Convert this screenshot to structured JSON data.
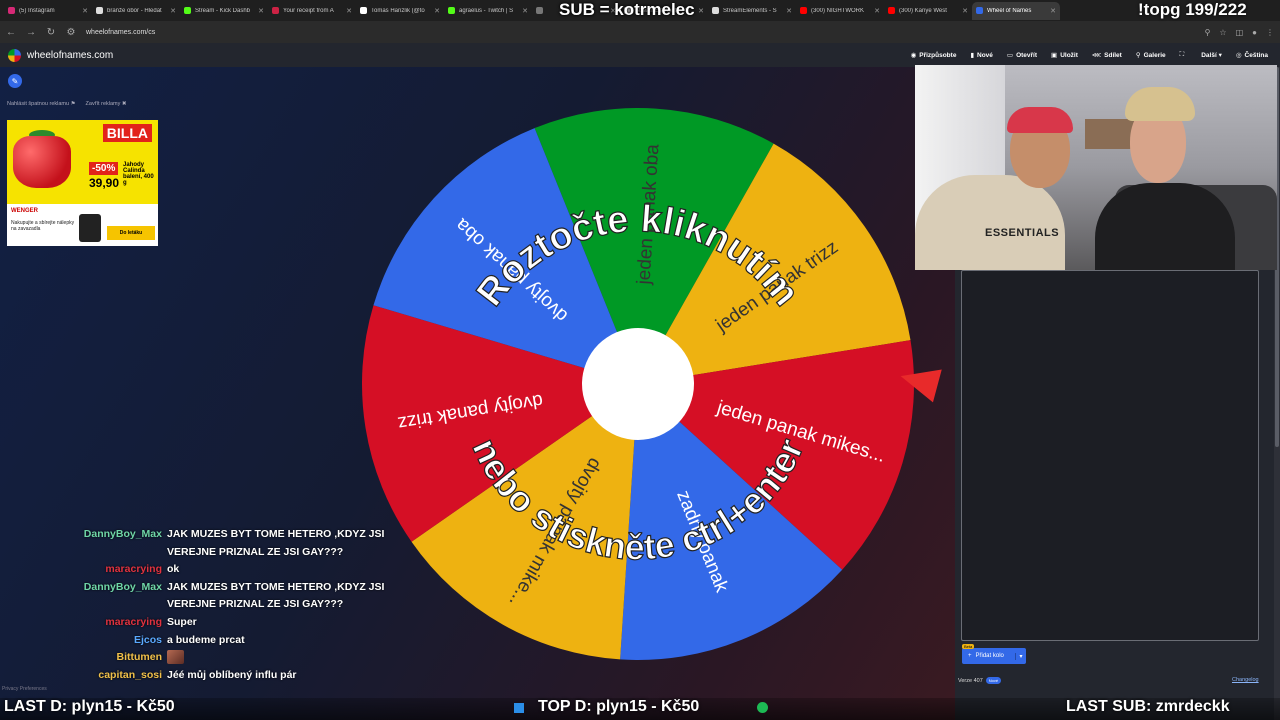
{
  "browser": {
    "tabs": [
      {
        "label": "(5) Instagram",
        "color": "#d62976"
      },
      {
        "label": "branže obor - Hledat",
        "color": "#dddddd"
      },
      {
        "label": "Stream - Kick Dashb",
        "color": "#53fc18"
      },
      {
        "label": "Your receipt from A",
        "color": "#cc2244"
      },
      {
        "label": "Tomas Hanzlik (@to",
        "color": "#ffffff"
      },
      {
        "label": "agraelus - Twitch | S",
        "color": "#53fc18"
      },
      {
        "label": "",
        "color": "#777777"
      },
      {
        "label": "StreamElements - S",
        "color": "#dddddd"
      },
      {
        "label": "StreamElements - S",
        "color": "#dddddd"
      },
      {
        "label": "(300) NIGHTWORK",
        "color": "#ff0000"
      },
      {
        "label": "(300) Kanye West",
        "color": "#ff0000"
      },
      {
        "label": "Wheel of Names",
        "color": "#3369e8"
      }
    ],
    "url": "wheelofnames.com/cs"
  },
  "site": {
    "name": "wheelofnames.com",
    "menu": [
      "Přizpůsobte",
      "Nové",
      "Otevřít",
      "Uložit",
      "Sdílet",
      "Galerie",
      "",
      "Další",
      "Čeština"
    ]
  },
  "ad": {
    "links": [
      "Nahlásit špatnou reklamu",
      "Zavřít reklamy"
    ],
    "brand": "BILLA",
    "discount": "-50%",
    "price": "39,90",
    "product": "Jahody Calinda balení, 400 g",
    "partner": "WENGER",
    "text": "Nakupujte a sbírejte nálepky na zavazadla",
    "cta": "Do letáku"
  },
  "wheel": {
    "overlay_top": "Roztočte kliknutím",
    "overlay_bottom": "nebo stiskněte ctrl+enter",
    "colors": {
      "blue": "#3369e8",
      "red": "#d50f25",
      "yellow": "#eeb211",
      "green": "#009925"
    },
    "segments": [
      {
        "label": "jeden panak oba",
        "color": "#009925"
      },
      {
        "label": "jeden panak trizz",
        "color": "#eeb211"
      },
      {
        "label": "jeden panak mikes...",
        "color": "#d50f25"
      },
      {
        "label": "zadny panak",
        "color": "#3369e8"
      },
      {
        "label": "dvojty panak mike...",
        "color": "#eeb211"
      },
      {
        "label": "dvojty panak trizz",
        "color": "#d50f25"
      },
      {
        "label": "dvojty panak oba",
        "color": "#3369e8"
      }
    ]
  },
  "panel": {
    "add_wheel": "Přidat kolo",
    "beta": "Beta",
    "version": "Verze 407",
    "version_badge": "Nové",
    "changelog": "Changelog"
  },
  "webcam": {
    "shirt_text": "ESSENTIALS"
  },
  "chat": [
    {
      "user": "DannyBoy_Max",
      "color": "#6fd6a7",
      "msg": "JAK MUZES BYT TOME HETERO ,KDYZ JSI VEREJNE PRIZNAL ZE JSI GAY???"
    },
    {
      "user": "maracrying",
      "color": "#e0323f",
      "msg": "ok"
    },
    {
      "user": "DannyBoy_Max",
      "color": "#6fd6a7",
      "msg": "JAK MUZES BYT TOME HETERO ,KDYZ JSI VEREJNE PRIZNAL ZE JSI GAY???"
    },
    {
      "user": "maracrying",
      "color": "#e0323f",
      "msg": "Super"
    },
    {
      "user": "Ejcos",
      "color": "#5aa9ff",
      "msg": "a budeme prcat"
    },
    {
      "user": "Bittumen",
      "color": "#f0c04a",
      "msg": ""
    },
    {
      "user": "capitan_sosi",
      "color": "#f0c04a",
      "msg": "Jéé můj oblíbený influ pár"
    }
  ],
  "overlay": {
    "sub": "SUB = kotrmelec",
    "topg": "!topg 199/222",
    "last_d": "LAST D: plyn15 - Kč50",
    "top_d": "TOP D: plyn15 - Kč50",
    "last_sub": "LAST SUB: zmrdeckk"
  },
  "privacy": "Privacy Preferences"
}
